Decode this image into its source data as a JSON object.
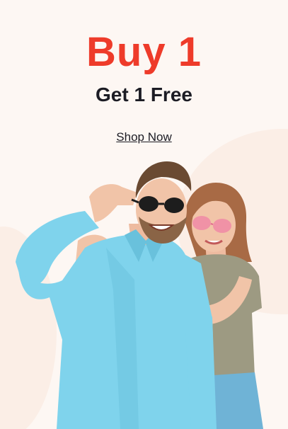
{
  "promo": {
    "headline": "Buy 1",
    "subheadline": "Get 1 Free",
    "cta_label": "Shop Now"
  },
  "colors": {
    "background": "#fdf7f3",
    "headline": "#ee3b2a",
    "text": "#1c1c24"
  },
  "image": {
    "icon": "couple-wearing-sunglasses-photo"
  }
}
